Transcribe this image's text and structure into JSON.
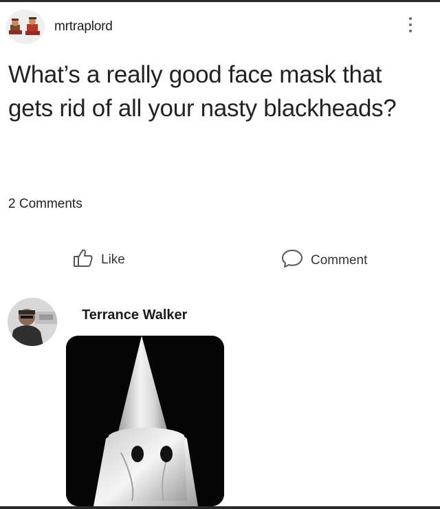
{
  "post": {
    "username": "mrtraplord",
    "text": "What’s a really good face mask that gets rid of all your nasty blackheads?",
    "comments_count": "2 Comments"
  },
  "actions": {
    "like_label": "Like",
    "comment_label": "Comment"
  },
  "comment": {
    "author": "Terrance Walker"
  },
  "icons": {
    "more": "more-vertical-icon",
    "like": "thumbs-up-icon",
    "comment": "speech-bubble-icon"
  },
  "colors": {
    "text": "#222222",
    "icon": "#6b6b6b",
    "background": "#ffffff"
  }
}
